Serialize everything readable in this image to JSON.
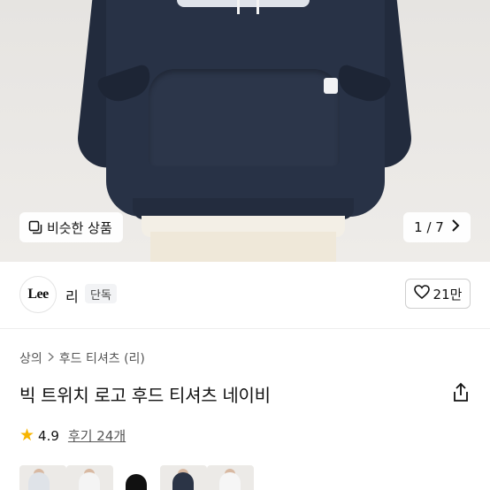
{
  "hero": {
    "similar_label": "비슷한 상품",
    "counter_current": "1",
    "counter_total": "7",
    "counter_text": "1 / 7"
  },
  "brand": {
    "logo_text": "Lee",
    "name": "리",
    "badge": "단독",
    "like_count": "21만"
  },
  "breadcrumb": [
    "상의",
    "후드 티셔츠 (리)"
  ],
  "product": {
    "title": "빅 트위치 로고 후드 티셔츠 네이비",
    "rating": "4.9",
    "reviews_label": "후기 24개"
  },
  "colors": {
    "star": "#f7b500",
    "hoodie_navy": "#283246",
    "border": "#cfcfcf"
  },
  "icons": {
    "similar": "similar-products-icon",
    "next": "chevron-right-icon",
    "like": "heart-icon",
    "share": "share-icon",
    "star": "star-icon"
  }
}
